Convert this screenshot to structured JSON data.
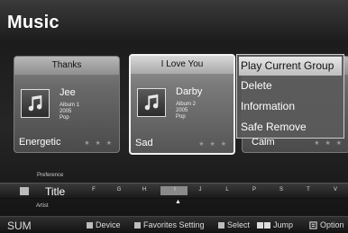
{
  "app": {
    "title": "Music"
  },
  "cards": [
    {
      "header": "Thanks",
      "artist": "Jee",
      "album": "Album 1",
      "year": "2005",
      "genre": "Pop",
      "mood": "Energetic",
      "stars": "★ ★ ★"
    },
    {
      "header": "I Love You",
      "artist": "Darby",
      "album": "Album 2",
      "year": "2005",
      "genre": "Pop",
      "mood": "Sad",
      "stars": "★ ★ ★"
    },
    {
      "header": "",
      "artist": "",
      "album": "",
      "year": "",
      "genre": "",
      "mood": "Calm",
      "stars": "★ ★ ★"
    }
  ],
  "context_menu": {
    "items": [
      "Play Current Group",
      "Delete",
      "Information",
      "Safe Remove"
    ],
    "selected_index": 0
  },
  "sort": {
    "above": "Preference",
    "current": "Title",
    "below": "Artist",
    "letters": [
      "F",
      "G",
      "H",
      "I",
      "J",
      "L",
      "P",
      "S",
      "T",
      "V"
    ],
    "highlighted": "I"
  },
  "bottom_bar": {
    "sum": "SUM",
    "device": "Device",
    "favorites": "Favorites Setting",
    "select": "Select",
    "jump": "Jump",
    "option": "Option"
  },
  "colors": {
    "selected_menu": "#d4d4d4",
    "background": "#1c1c1c"
  },
  "icons": [
    "music-note-icon",
    "star-icon",
    "sort-icon",
    "jump-icon",
    "option-icon"
  ]
}
